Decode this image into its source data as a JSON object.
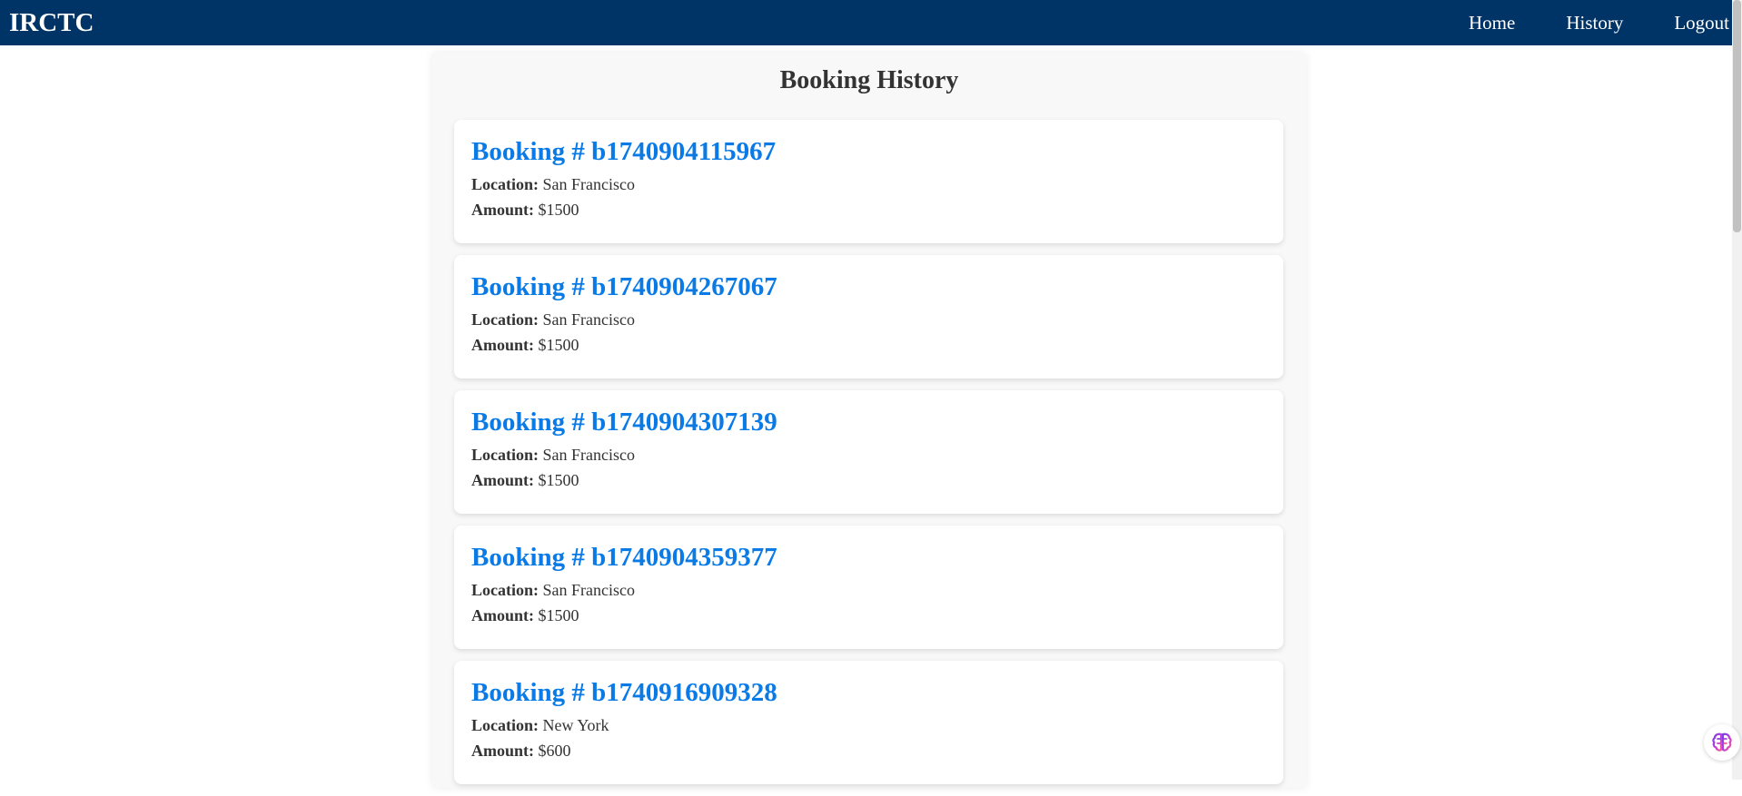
{
  "navbar": {
    "brand": "IRCTC",
    "links": [
      "Home",
      "History",
      "Logout"
    ]
  },
  "page": {
    "title": "Booking History"
  },
  "labels": {
    "location": "Location:",
    "amount": "Amount:"
  },
  "bookings": [
    {
      "heading": "Booking # b1740904115967",
      "location": "San Francisco",
      "amount": "$1500"
    },
    {
      "heading": "Booking # b1740904267067",
      "location": "San Francisco",
      "amount": "$1500"
    },
    {
      "heading": "Booking # b1740904307139",
      "location": "San Francisco",
      "amount": "$1500"
    },
    {
      "heading": "Booking # b1740904359377",
      "location": "San Francisco",
      "amount": "$1500"
    },
    {
      "heading": "Booking # b1740916909328",
      "location": "New York",
      "amount": "$600"
    }
  ],
  "colors": {
    "navbar": "#003366",
    "accent": "#0a7be6"
  },
  "icons": {
    "assistant": "brain-icon"
  }
}
